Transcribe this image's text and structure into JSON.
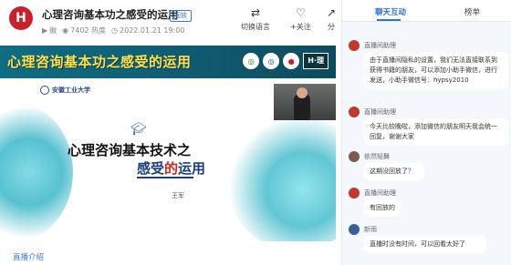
{
  "header": {
    "logo_letter": "H",
    "title": "心理咨询基本功之感受的运用",
    "badge": "回放",
    "meta": {
      "author": "徽",
      "heat": "7402 热度",
      "datetime": "2022.01.21 19:00"
    },
    "actions": [
      {
        "label": "切换语言",
        "icon": "translate-icon",
        "glyph": "⇄"
      },
      {
        "label": "+关注",
        "icon": "follow-icon",
        "glyph": "♡"
      },
      {
        "label": "分",
        "icon": "share-icon",
        "glyph": "↗"
      }
    ]
  },
  "video": {
    "banner_title": "心理咨询基本功之感受的运用",
    "banner_brand": "H·理",
    "school_name": "安徽工业大学",
    "slide_main": "心理咨询基本技术之",
    "slide_sub_a": "感受",
    "slide_sub_b": "的",
    "slide_sub_c": "运用",
    "slide_author": "王军"
  },
  "footer": {
    "intro_label": "直播介绍"
  },
  "chat": {
    "tabs": [
      {
        "label": "聊天互动"
      },
      {
        "label": "榜单"
      }
    ],
    "messages": [
      {
        "name": "直播间助理",
        "text": "由于直播间隐私的设置，我们无法直接联系到获得书籍的朋友，可以添加小助手微信，进行发送，小助手微信号：hypsy2010",
        "avatar_color": "#c0392b"
      },
      {
        "name": "直播间助理",
        "text": "今天比较晚啦，添加微信的朋友明天我会统一回复，谢谢大家",
        "avatar_color": "#c0392b"
      },
      {
        "name": "依然轻舞",
        "text": "这期没回放了？",
        "avatar_color": "#7d5a4a"
      },
      {
        "name": "直播间助理",
        "text": "有回放的",
        "avatar_color": "#c0392b"
      },
      {
        "name": "新雨",
        "text": "直播时没有时间，可以回看太好了",
        "avatar_color": "#3a5f9a"
      }
    ]
  }
}
